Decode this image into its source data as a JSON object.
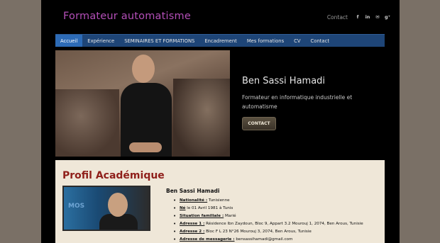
{
  "header": {
    "site_title": "Formateur automatisme",
    "contact_link": "Contact",
    "social": [
      {
        "icon": "facebook-icon",
        "glyph": "f"
      },
      {
        "icon": "linkedin-icon",
        "glyph": "in"
      },
      {
        "icon": "email-icon",
        "glyph": "✉"
      },
      {
        "icon": "googleplus-icon",
        "glyph": "g⁺"
      }
    ]
  },
  "nav": {
    "items": [
      "Accueil",
      "Expérience",
      "SEMINAIRES ET FORMATIONS",
      "Encadrement",
      "Mes formations",
      "CV",
      "Contact"
    ],
    "active_index": 0
  },
  "hero": {
    "name": "Ben Sassi Hamadi",
    "subtitle": "Formateur en informatique industrielle et automatisme",
    "button": "CONTACT"
  },
  "profile": {
    "title": "Profil Académique",
    "photo_text": "MOS",
    "name": "Ben Sassi Hamadi",
    "details": [
      {
        "label": "Nationalité :",
        "value": " Tunisienne"
      },
      {
        "label": "Né",
        "value": " le 01 Avril 1981 à Tunis"
      },
      {
        "label": "Situation familiale :",
        "value": " Marié"
      },
      {
        "label": "Adresse 1 :",
        "value": " Résidence Ibn Zaydoun, Bloc 9, Appart 3.2 Mourouj 1, 2074, Ben Arous, Tunisie"
      },
      {
        "label": "Adresse 2 :",
        "value": " Bloc F L 23 N°26 Mourouj 3, 2074, Ben Arous, Tunisie"
      },
      {
        "label": "Adresse de messagerie :",
        "value": " bensassihamadi@gmail.com"
      }
    ]
  },
  "colors": {
    "background": "#7a7066",
    "page": "#000000",
    "title_purple": "#b44fb8",
    "nav_bar": "#1e4577",
    "nav_active": "#2d6bb6",
    "profile_bg": "#efe7d8",
    "profile_title": "#8f1f1a"
  }
}
